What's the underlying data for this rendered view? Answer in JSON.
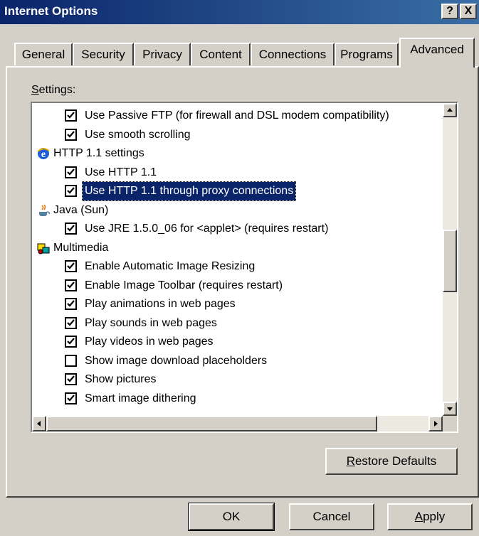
{
  "window": {
    "title": "Internet Options"
  },
  "titlebar_buttons": {
    "help": "?",
    "close": "X"
  },
  "tabs": [
    {
      "label": "General"
    },
    {
      "label": "Security"
    },
    {
      "label": "Privacy"
    },
    {
      "label": "Content"
    },
    {
      "label": "Connections"
    },
    {
      "label": "Programs"
    },
    {
      "label": "Advanced",
      "active": true
    }
  ],
  "settings_label": {
    "prefix": "S",
    "rest": "ettings:"
  },
  "settings": [
    {
      "type": "item",
      "label": "Use Passive FTP (for firewall and DSL modem compatibility)",
      "checked": true
    },
    {
      "type": "item",
      "label": "Use smooth scrolling",
      "checked": true
    },
    {
      "type": "group",
      "label": "HTTP 1.1 settings",
      "icon": "ie-icon"
    },
    {
      "type": "item",
      "label": "Use HTTP 1.1",
      "checked": true
    },
    {
      "type": "item",
      "label": "Use HTTP 1.1 through proxy connections",
      "checked": true,
      "selected": true
    },
    {
      "type": "group",
      "label": "Java (Sun)",
      "icon": "java-icon"
    },
    {
      "type": "item",
      "label": "Use JRE 1.5.0_06 for <applet> (requires restart)",
      "checked": true
    },
    {
      "type": "group",
      "label": "Multimedia",
      "icon": "multimedia-icon"
    },
    {
      "type": "item",
      "label": "Enable Automatic Image Resizing",
      "checked": true
    },
    {
      "type": "item",
      "label": "Enable Image Toolbar (requires restart)",
      "checked": true
    },
    {
      "type": "item",
      "label": "Play animations in web pages",
      "checked": true
    },
    {
      "type": "item",
      "label": "Play sounds in web pages",
      "checked": true
    },
    {
      "type": "item",
      "label": "Play videos in web pages",
      "checked": true
    },
    {
      "type": "item",
      "label": "Show image download placeholders",
      "checked": false
    },
    {
      "type": "item",
      "label": "Show pictures",
      "checked": true
    },
    {
      "type": "item",
      "label": "Smart image dithering",
      "checked": true
    }
  ],
  "buttons": {
    "restore_prefix": "R",
    "restore_rest": "estore Defaults",
    "ok": "OK",
    "cancel": "Cancel",
    "apply_prefix": "A",
    "apply_rest": "pply"
  },
  "colors": {
    "titlebar": "#0a246a",
    "selection": "#0a246a",
    "face": "#d4d0c8"
  }
}
